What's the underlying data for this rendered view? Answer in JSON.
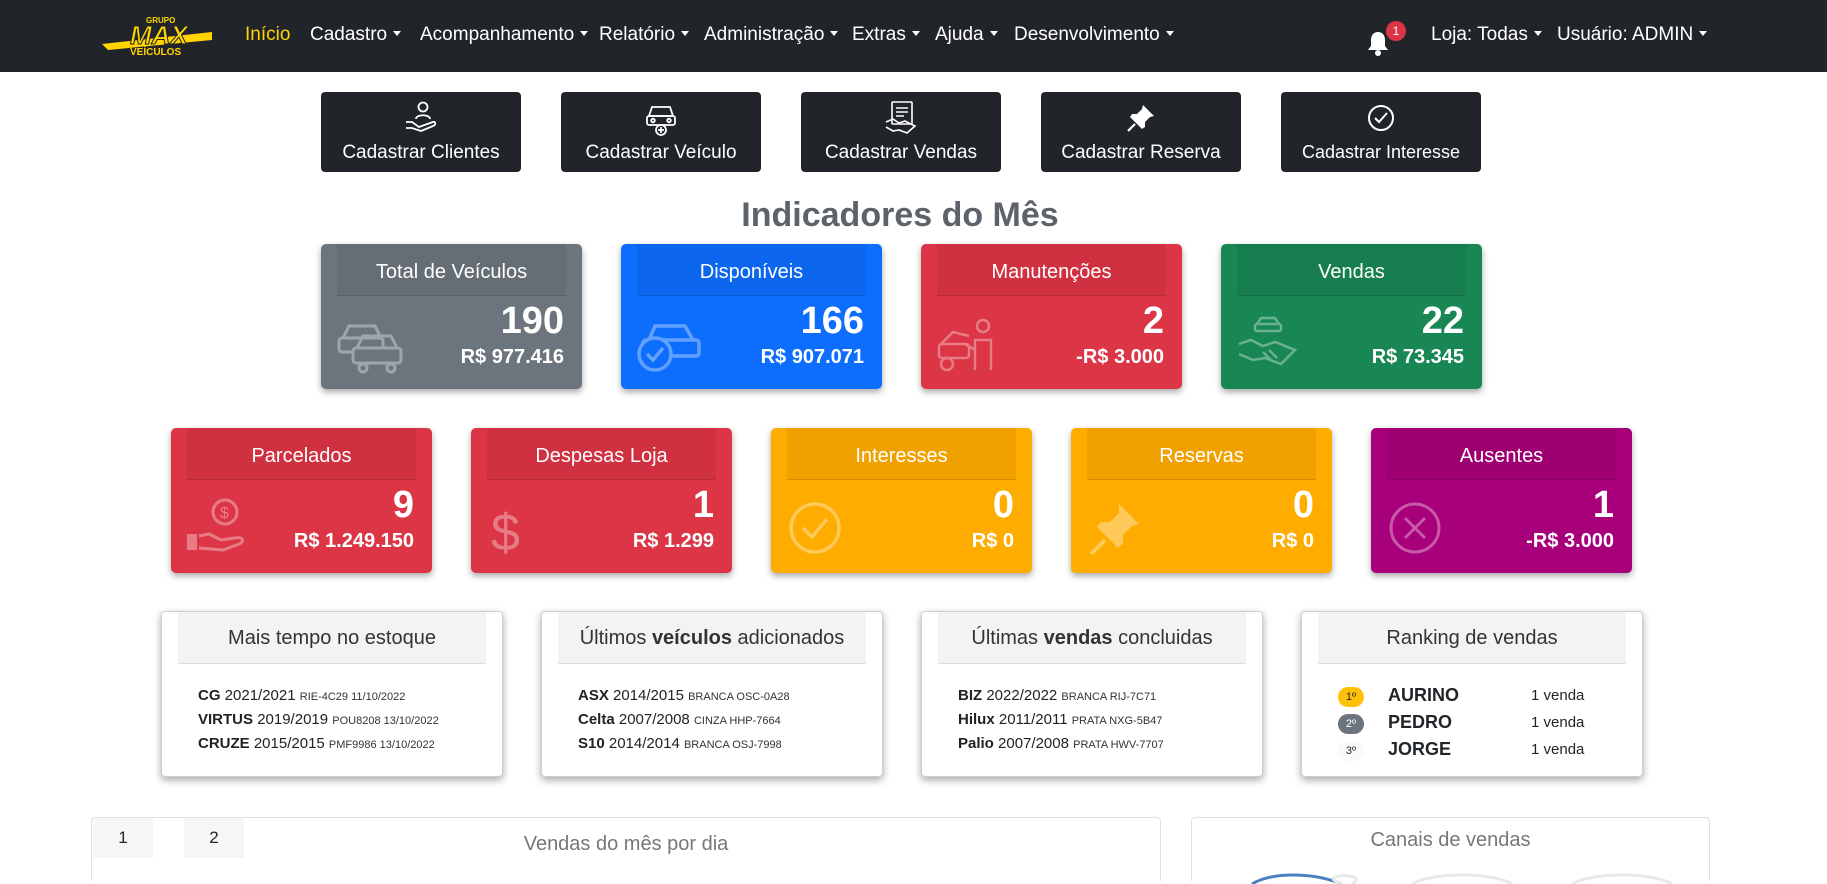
{
  "brand": {
    "top": "GRUPO",
    "main": "MAX",
    "sub": "VEÍCULOS",
    "color": "#ffd400"
  },
  "nav": {
    "items": [
      {
        "label": "Início",
        "caret": false
      },
      {
        "label": "Cadastro",
        "caret": true
      },
      {
        "label": "Acompanhamento",
        "caret": true
      },
      {
        "label": "Relatório",
        "caret": true
      },
      {
        "label": "Administração",
        "caret": true
      },
      {
        "label": "Extras",
        "caret": true
      },
      {
        "label": "Ajuda",
        "caret": true
      },
      {
        "label": "Desenvolvimento",
        "caret": true
      }
    ],
    "notifications": "1",
    "store_label": "Loja: Todas",
    "user_label": "Usuário: ADMIN"
  },
  "quick_actions": [
    {
      "label": "Cadastrar Clientes",
      "icon": "hand-user-icon"
    },
    {
      "label": "Cadastrar Veículo",
      "icon": "car-plus-icon"
    },
    {
      "label": "Cadastrar Vendas",
      "icon": "handshake-document-icon"
    },
    {
      "label": "Cadastrar Reserva",
      "icon": "pin-icon"
    },
    {
      "label": "Cadastrar Interesse",
      "icon": "check-circle-icon"
    }
  ],
  "indicators_title": "Indicadores do Mês",
  "cards_row1": [
    {
      "title": "Total de Veículos",
      "count": "190",
      "value": "R$ 977.416",
      "color": "#6c757d",
      "icon": "cars-icon"
    },
    {
      "title": "Disponíveis",
      "count": "166",
      "value": "R$ 907.071",
      "color": "#0d6efd",
      "icon": "car-check-icon"
    },
    {
      "title": "Manutenções",
      "count": "2",
      "value": "-R$ 3.000",
      "color": "#dc3545",
      "icon": "mechanic-icon"
    },
    {
      "title": "Vendas",
      "count": "22",
      "value": "R$ 73.345",
      "color": "#198754",
      "icon": "handshake-icon"
    }
  ],
  "cards_row2": [
    {
      "title": "Parcelados",
      "count": "9",
      "value": "R$ 1.249.150",
      "color": "#dc3545",
      "icon": "hand-coin-icon"
    },
    {
      "title": "Despesas Loja",
      "count": "1",
      "value": "R$ 1.299",
      "color": "#dc3545",
      "icon": "dollar-icon"
    },
    {
      "title": "Interesses",
      "count": "0",
      "value": "R$ 0",
      "color": "#ffac00",
      "icon": "check-circle-icon"
    },
    {
      "title": "Reservas",
      "count": "0",
      "value": "R$ 0",
      "color": "#ffac00",
      "icon": "pin-icon"
    },
    {
      "title": "Ausentes",
      "count": "1",
      "value": "-R$ 3.000",
      "color": "#a8007a",
      "icon": "x-circle-icon"
    }
  ],
  "panels": {
    "stock": {
      "title": "Mais tempo no estoque",
      "rows": [
        {
          "model": "CG",
          "year": "2021/2021",
          "detail": "RIE-4C29 11/10/2022"
        },
        {
          "model": "VIRTUS",
          "year": "2019/2019",
          "detail": "POU8208 13/10/2022"
        },
        {
          "model": "CRUZE",
          "year": "2015/2015",
          "detail": "PMF9986 13/10/2022"
        }
      ]
    },
    "vehicles": {
      "title_pre": "Últimos ",
      "title_bold": "veículos",
      "title_post": " adicionados",
      "rows": [
        {
          "model": "ASX",
          "year": "2014/2015",
          "detail": "BRANCA OSC-0A28"
        },
        {
          "model": "Celta",
          "year": "2007/2008",
          "detail": "CINZA HHP-7664"
        },
        {
          "model": "S10",
          "year": "2014/2014",
          "detail": "BRANCA OSJ-7998"
        }
      ]
    },
    "sales": {
      "title_pre": "Últimas ",
      "title_bold": "vendas",
      "title_post": " concluidas",
      "rows": [
        {
          "model": "BIZ",
          "year": "2022/2022",
          "detail": "BRANCA RIJ-7C71"
        },
        {
          "model": "Hilux",
          "year": "2011/2011",
          "detail": "PRATA NXG-5B47"
        },
        {
          "model": "Palio",
          "year": "2007/2008",
          "detail": "PRATA HWV-7707"
        }
      ]
    },
    "ranking": {
      "title": "Ranking de vendas",
      "rows": [
        {
          "pos": "1º",
          "name": "AURINO",
          "count": "1 venda",
          "badge_color": "#ffc107",
          "text_color": "#222"
        },
        {
          "pos": "2º",
          "name": "PEDRO",
          "count": "1 venda",
          "badge_color": "#6c757d",
          "text_color": "#fff"
        },
        {
          "pos": "3º",
          "name": "JORGE",
          "count": "1 venda",
          "badge_color": "#f8f9fa",
          "text_color": "#222"
        }
      ]
    }
  },
  "bottom": {
    "tabs": [
      "1",
      "2"
    ],
    "daily_title": "Vendas do mês por dia",
    "channels_title": "Canais de vendas"
  }
}
